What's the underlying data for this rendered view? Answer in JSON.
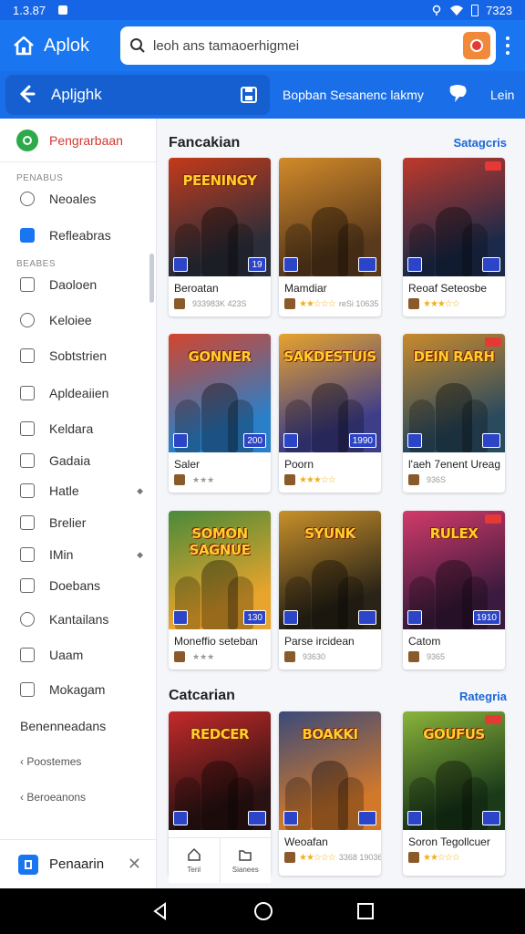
{
  "status_bar": {
    "time": "1.3.87",
    "battery": "7323"
  },
  "app_bar": {
    "title": "Aplok",
    "search_text": "leoh ans tamaoerhigmei"
  },
  "sub_bar": {
    "label": "Apljghk",
    "promo": "Bopban Sesanenc lakmy",
    "more": "Lein"
  },
  "sidebar": {
    "header": "Pengrarbaan",
    "section_1": "PENABUS",
    "items_1": [
      {
        "label": "Neoales",
        "icon": "clock-icon"
      },
      {
        "label": "Refleabras",
        "icon": "checkbox-icon"
      }
    ],
    "section_2": "BEABES",
    "items_2": [
      {
        "label": "Daoloen",
        "icon": "folder-icon"
      },
      {
        "label": "Keloiee",
        "icon": "circle-icon"
      },
      {
        "label": "Sobtstrien",
        "icon": "archive-icon"
      },
      {
        "label": "Apldeaiien",
        "icon": "app-icon"
      },
      {
        "label": "Keldara",
        "icon": "calendar-icon"
      },
      {
        "label": "Gadaia",
        "icon": "mail-icon"
      },
      {
        "label": "Hatle",
        "icon": "close-box-icon",
        "expandable": true
      },
      {
        "label": "Brelier",
        "icon": "box-icon"
      },
      {
        "label": "IMin",
        "icon": "sort-icon",
        "expandable": true
      },
      {
        "label": "Doebans",
        "icon": "folder-icon"
      },
      {
        "label": "Kantailans",
        "icon": "check-circle-icon"
      },
      {
        "label": "Uaam",
        "icon": "lock-icon"
      },
      {
        "label": "Mokagam",
        "icon": "tag-icon"
      }
    ],
    "extra_1": "Benenneadans",
    "extra_2": "Poostemes",
    "extra_3": "Beroeanons",
    "footer": "Penaarin"
  },
  "section_1": {
    "title": "Fancakian",
    "link": "Satagcris"
  },
  "section_2": {
    "title": "Catcarian",
    "link": "Rategria"
  },
  "games": [
    {
      "name": "Beroatan",
      "meta": "933983K 423S",
      "logo": "PEENINGY",
      "badge": "19",
      "colors": [
        "#2b2e3a",
        "#c43a1a"
      ],
      "stars": ""
    },
    {
      "name": "Mamdiar",
      "meta": "reSi 10635",
      "logo": "",
      "badge": "",
      "colors": [
        "#5a3a1c",
        "#d28a2a"
      ],
      "stars": "★★☆☆☆"
    },
    {
      "name": "Reoaf Seteosbe",
      "meta": "",
      "logo": "",
      "badge": "",
      "colors": [
        "#1b2a4a",
        "#c0392b"
      ],
      "stars": "★★★☆☆"
    },
    {
      "name": "Saler",
      "meta": "★★★",
      "logo": "GONNER",
      "badge": "200",
      "colors": [
        "#2a7fc9",
        "#d2452c"
      ],
      "stars": ""
    },
    {
      "name": "Poorn",
      "meta": "",
      "logo": "SAKDESTUIS",
      "badge": "1990",
      "colors": [
        "#3d3d8a",
        "#e8a32c"
      ],
      "stars": "★★★☆☆"
    },
    {
      "name": "l'aeh 7enent Ureag",
      "meta": "936S",
      "logo": "DEIN RARH",
      "badge": "",
      "colors": [
        "#2a4a5e",
        "#c98a2c"
      ],
      "stars": ""
    },
    {
      "name": "Moneffio seteban",
      "meta": "★★★",
      "logo": "SOMON SAGNUE",
      "badge": "130",
      "colors": [
        "#e8a42c",
        "#4a8a3a"
      ],
      "stars": ""
    },
    {
      "name": "Parse ircidean",
      "meta": "93630",
      "logo": "SYUNK",
      "badge": "",
      "colors": [
        "#2a2418",
        "#c8902a"
      ],
      "stars": ""
    },
    {
      "name": "Catom",
      "meta": "9365",
      "logo": "RULEX",
      "badge": "1910",
      "colors": [
        "#3a1a3e",
        "#d23a6a"
      ],
      "stars": ""
    },
    {
      "name": "",
      "meta": "",
      "logo": "REDCER",
      "badge": "",
      "colors": [
        "#2a1212",
        "#c42a2a"
      ],
      "stars": ""
    },
    {
      "name": "Weoafan",
      "meta": "3368 19036",
      "logo": "BOAKKI",
      "badge": "",
      "colors": [
        "#d2782a",
        "#3a4a7a"
      ],
      "stars": "★★☆☆☆"
    },
    {
      "name": "Soron Tegollcuer",
      "meta": "",
      "logo": "GOUFUS",
      "badge": "",
      "colors": [
        "#1a3a1a",
        "#8ab43a"
      ],
      "stars": "★★☆☆☆"
    }
  ],
  "bottom_nav": {
    "home": "Tenl",
    "saved": "Sianees"
  }
}
